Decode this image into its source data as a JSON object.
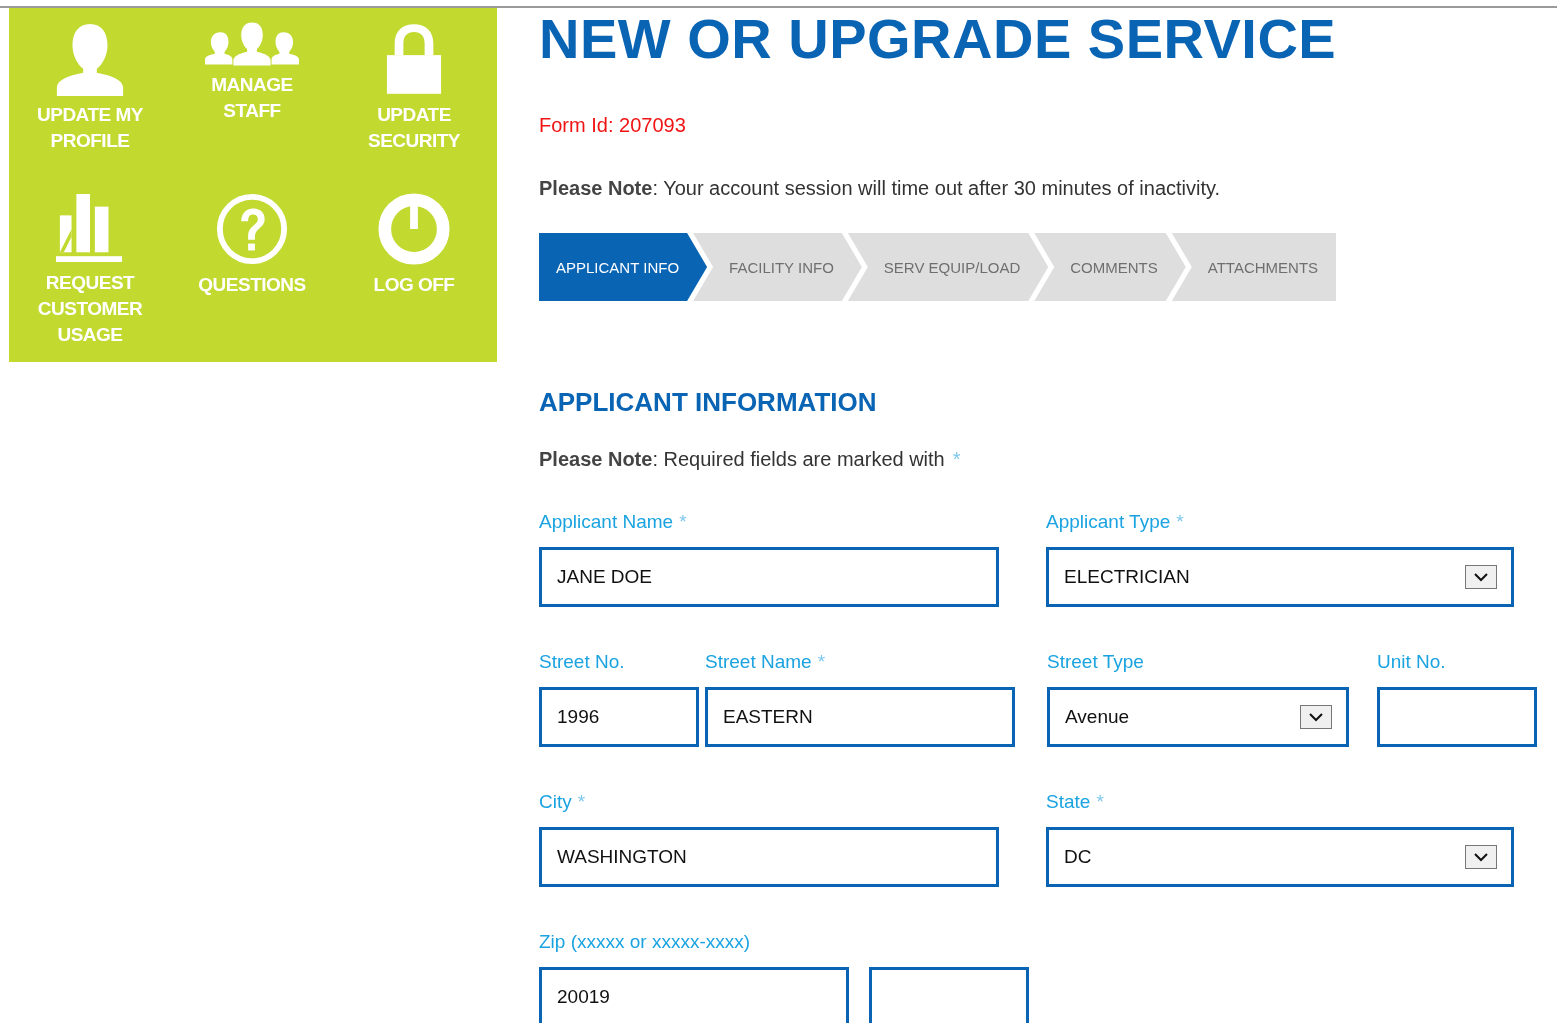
{
  "tiles": [
    {
      "label": "UPDATE MY PROFILE"
    },
    {
      "label": "MANAGE STAFF"
    },
    {
      "label": "UPDATE SECURITY"
    },
    {
      "label": "REQUEST CUSTOMER USAGE"
    },
    {
      "label": "QUESTIONS"
    },
    {
      "label": "LOG OFF"
    }
  ],
  "title": "NEW OR UPGRADE SERVICE",
  "form_id": "Form Id: 207093",
  "session_note": "**Please Note**: Your account session will time out after 30 minutes of inactivity.",
  "steps": [
    {
      "label": "APPLICANT INFO",
      "selected": true
    },
    {
      "label": "FACILITY INFO",
      "selected": false
    },
    {
      "label": "SERV EQUIP/LOAD",
      "selected": false
    },
    {
      "label": "COMMENTS",
      "selected": false
    },
    {
      "label": "ATTACHMENTS",
      "selected": false
    }
  ],
  "section_title": "APPLICANT INFORMATION",
  "required_note": {
    "text": "**Please Note**: Required fields are marked with",
    "required_mark": "*"
  },
  "rows": [
    [
      {
        "label": "Applicant Name",
        "required_mark": "*",
        "kind": "text",
        "value": "JANE DOE"
      },
      {
        "label": "Applicant Type",
        "required_mark": "*",
        "kind": "select",
        "value": "ELECTRICIAN"
      }
    ],
    [
      {
        "label": "Street No.",
        "kind": "text",
        "value": "1996"
      },
      {
        "label": "Street Name",
        "required_mark": "*",
        "kind": "text",
        "value": "EASTERN"
      },
      {
        "label": "Street Type",
        "kind": "select",
        "value": "Avenue"
      },
      {
        "label": "Unit No.",
        "kind": "text"
      }
    ],
    [
      {
        "label": "City",
        "required_mark": "*",
        "kind": "text",
        "value": "WASHINGTON"
      },
      {
        "label": "State",
        "required_mark": "*",
        "kind": "select",
        "value": "DC"
      }
    ],
    [
      {
        "label": "Zip (xxxxx or xxxxx-xxxx)",
        "kind": "text",
        "value": "20019"
      },
      {
        "kind": "text"
      }
    ]
  ]
}
